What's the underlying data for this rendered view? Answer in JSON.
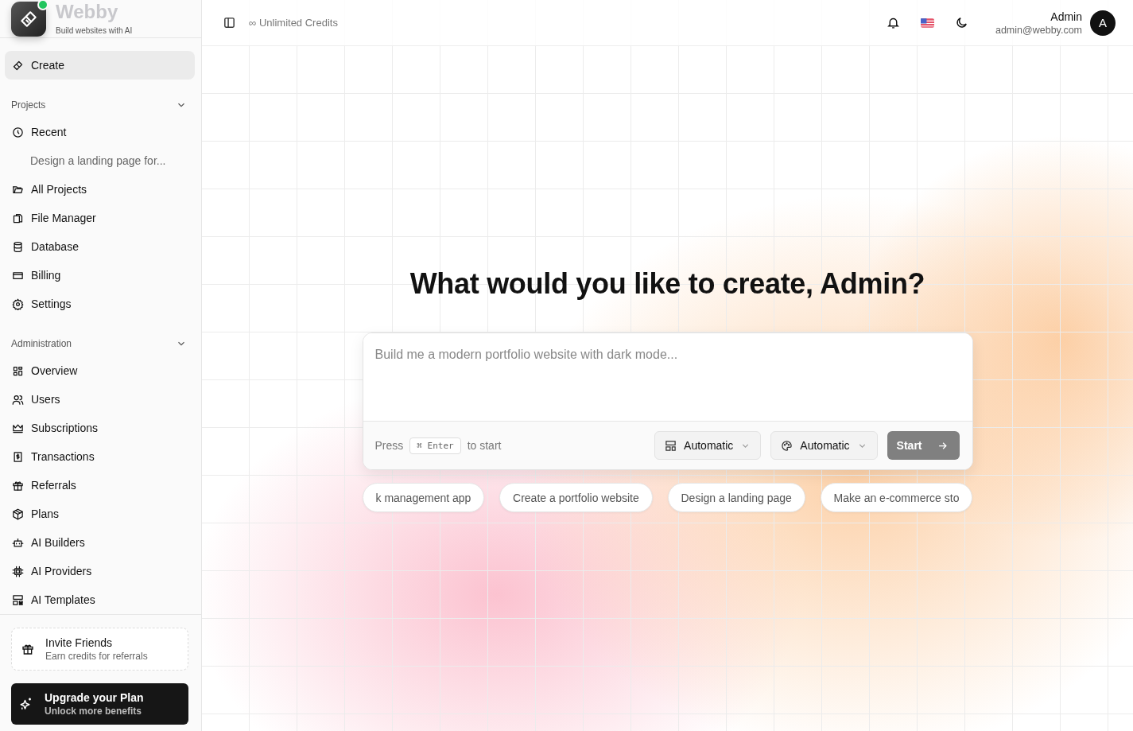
{
  "sidebar": {
    "brand": {
      "name": "Webby",
      "tagline": "Build websites with AI",
      "online": true
    },
    "create": {
      "label": "Create",
      "selected": true
    },
    "sections": [
      {
        "title": "Projects",
        "expanded": true,
        "items": [
          {
            "label": "Recent",
            "children": [
              {
                "label": "Design a landing page for..."
              }
            ]
          },
          {
            "label": "All Projects"
          },
          {
            "label": "File Manager"
          },
          {
            "label": "Database"
          },
          {
            "label": "Billing"
          },
          {
            "label": "Settings"
          }
        ]
      },
      {
        "title": "Administration",
        "expanded": true,
        "items": [
          {
            "label": "Overview"
          },
          {
            "label": "Users"
          },
          {
            "label": "Subscriptions"
          },
          {
            "label": "Transactions"
          },
          {
            "label": "Referrals"
          },
          {
            "label": "Plans"
          },
          {
            "label": "AI Builders"
          },
          {
            "label": "AI Providers"
          },
          {
            "label": "AI Templates"
          }
        ]
      }
    ],
    "invite": {
      "title": "Invite Friends",
      "subtitle": "Earn credits for referrals"
    },
    "upgrade": {
      "title": "Upgrade your Plan",
      "subtitle": "Unlock more benefits"
    }
  },
  "header": {
    "credits_symbol": "∞",
    "credits": "Unlimited Credits",
    "user": {
      "name": "Admin",
      "email": "admin@webby.com",
      "initial": "A"
    }
  },
  "main": {
    "heading": "What would you like to create, Admin?",
    "prompt": {
      "placeholder": "Build me a modern portfolio website with dark mode...",
      "hint_before": "Press",
      "key_symbol": "⌘",
      "key": "Enter",
      "hint_after": "to start",
      "selects": [
        {
          "label": "Automatic"
        },
        {
          "label": "Automatic"
        }
      ],
      "start": "Start",
      "start_disabled": true
    },
    "suggestions": [
      "k management app",
      "Create a portfolio website",
      "Design a landing page",
      "Make an e-commerce sto"
    ]
  }
}
